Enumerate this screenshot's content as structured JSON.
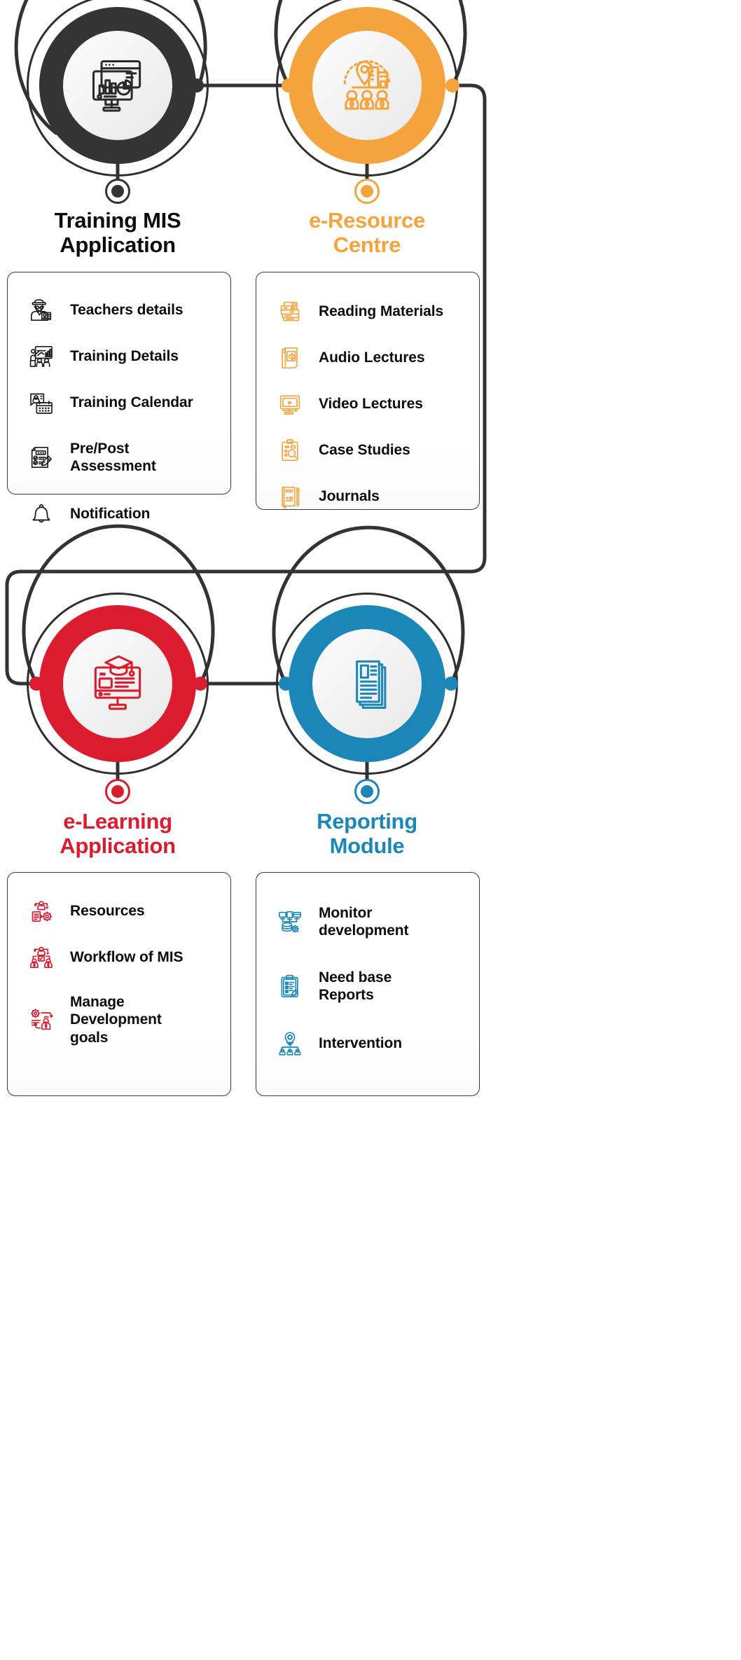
{
  "diagram": {
    "title_semantic": "training-ecosystem-modules",
    "colors": {
      "dark": "#343434",
      "orange": "#F5A33C",
      "red": "#DB1B2E",
      "blue": "#1B87B8",
      "wire": "#333333",
      "rule": "#7a7a7a"
    }
  },
  "nodes": [
    {
      "id": "training-mis-application",
      "title": "Training MIS\nApplication",
      "color": "#343434",
      "icon": "dashboard-monitor-icon"
    },
    {
      "id": "e-resource-centre",
      "title": "e-Resource\nCentre",
      "color": "#F5A33C",
      "icon": "location-people-icon"
    },
    {
      "id": "e-learning-application",
      "title": "e-Learning\nApplication",
      "color": "#DB1B2E",
      "icon": "graduation-monitor-icon"
    },
    {
      "id": "reporting-module",
      "title": "Reporting\nModule",
      "color": "#1B87B8",
      "icon": "documents-stack-icon"
    }
  ],
  "cards": [
    {
      "id": "training-mis-card",
      "accent": "#1c1c1c",
      "items": [
        {
          "label": "Teachers details",
          "icon": "teacher-badge-icon"
        },
        {
          "label": "Training Details",
          "icon": "training-presentation-icon"
        },
        {
          "label": "Training Calendar",
          "icon": "calendar-profile-icon"
        },
        {
          "label": "Pre/Post\nAssessment",
          "icon": "assessment-form-icon"
        }
      ],
      "loose_items": [
        {
          "label": "Notification",
          "icon": "bell-icon"
        }
      ]
    },
    {
      "id": "e-resource-centre-card",
      "accent": "#F5A33C",
      "items": [
        {
          "label": "Reading Materials",
          "icon": "book-stack-icon"
        },
        {
          "label": "Audio Lectures",
          "icon": "audio-book-icon"
        },
        {
          "label": "Video Lectures",
          "icon": "video-monitor-icon"
        },
        {
          "label": "Case Studies",
          "icon": "clipboard-search-icon"
        },
        {
          "label": "Journals",
          "icon": "journal-pen-icon"
        }
      ],
      "loose_items": []
    },
    {
      "id": "e-learning-card",
      "accent": "#DB1B2E",
      "items": [
        {
          "label": "Resources",
          "icon": "resource-gear-icon"
        },
        {
          "label": "Workflow of MIS",
          "icon": "workflow-people-icon"
        },
        {
          "label": "Manage\nDevelopment\ngoals",
          "icon": "manage-development-icon"
        }
      ],
      "loose_items": []
    },
    {
      "id": "reporting-module-card",
      "accent": "#1B87B8",
      "items": [
        {
          "label": "Monitor\ndevelopment",
          "icon": "server-monitor-icon"
        },
        {
          "label": "Need base\nReports",
          "icon": "clipboard-check-icon"
        },
        {
          "label": "Intervention",
          "icon": "idea-people-icon"
        }
      ],
      "loose_items": []
    }
  ]
}
